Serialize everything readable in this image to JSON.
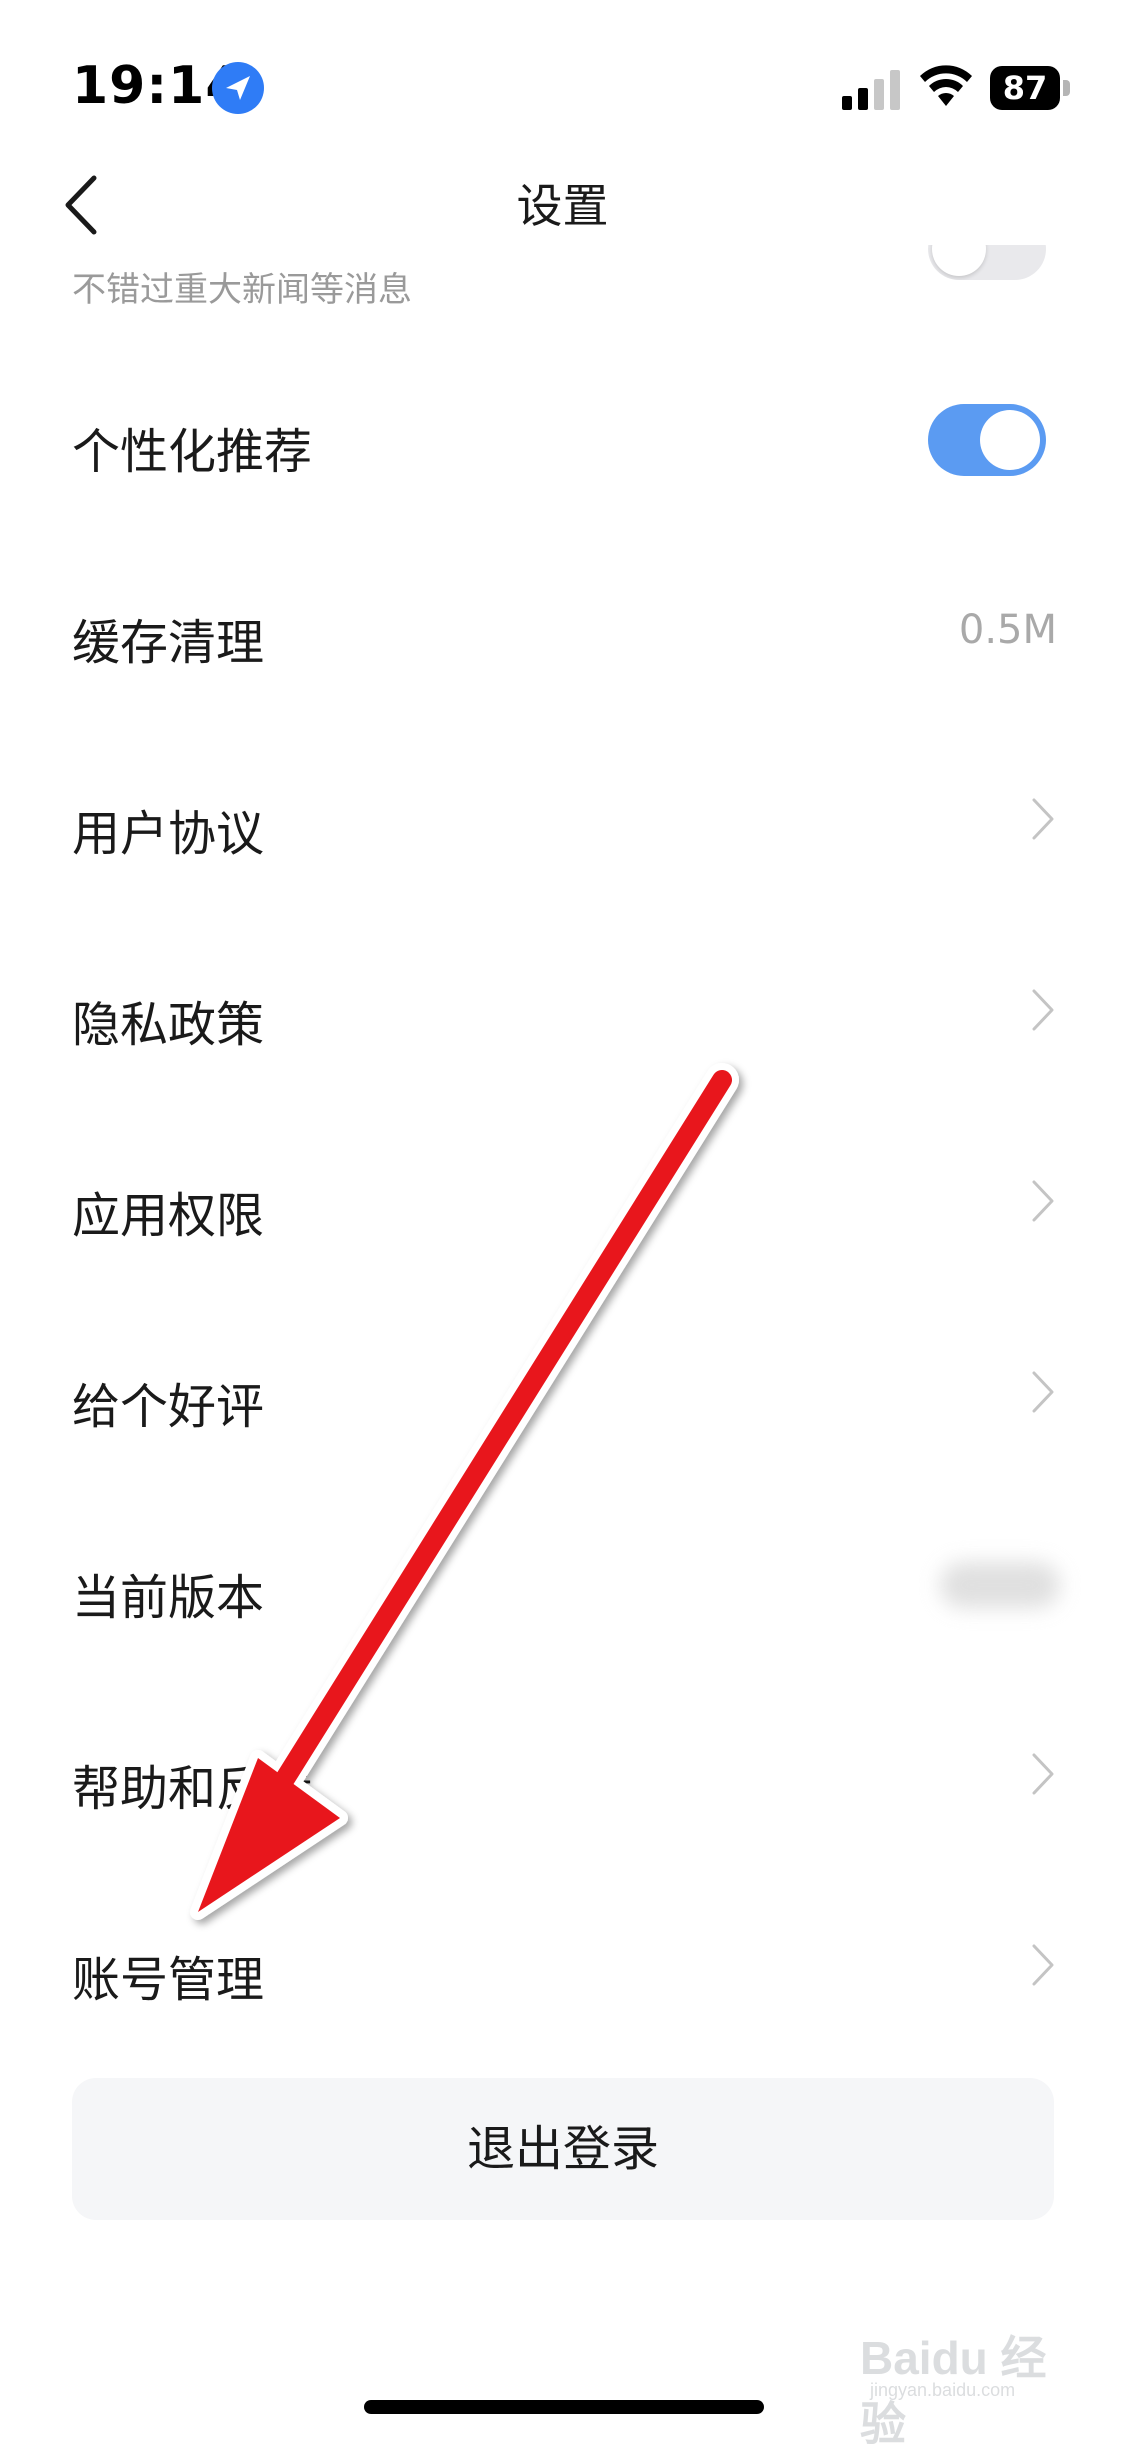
{
  "status_bar": {
    "time": "19:14",
    "battery": "87",
    "location_icon": "location-arrow-icon",
    "signal_icon": "cellular-signal-icon",
    "wifi_icon": "wifi-icon"
  },
  "header": {
    "title": "设置",
    "back_icon": "chevron-left-icon"
  },
  "partial_row": {
    "subtitle": "不错过重大新闻等消息",
    "toggle_on": false
  },
  "rows": [
    {
      "label": "个性化推荐",
      "type": "toggle",
      "toggle_on": true
    },
    {
      "label": "缓存清理",
      "type": "value",
      "value": "0.5M"
    },
    {
      "label": "用户协议",
      "type": "link"
    },
    {
      "label": "隐私政策",
      "type": "link"
    },
    {
      "label": "应用权限",
      "type": "link"
    },
    {
      "label": "给个好评",
      "type": "link"
    },
    {
      "label": "当前版本",
      "type": "blurred"
    },
    {
      "label": "帮助和反馈",
      "type": "link"
    },
    {
      "label": "账号管理",
      "type": "link"
    }
  ],
  "logout": {
    "label": "退出登录"
  },
  "watermark": {
    "brand": "Baidu 经验",
    "site": "jingyan.baidu.com"
  },
  "colors": {
    "accent_toggle": "#5b9bf2",
    "annotation_arrow": "#e8131b",
    "secondary_text": "#a9a9a9"
  }
}
